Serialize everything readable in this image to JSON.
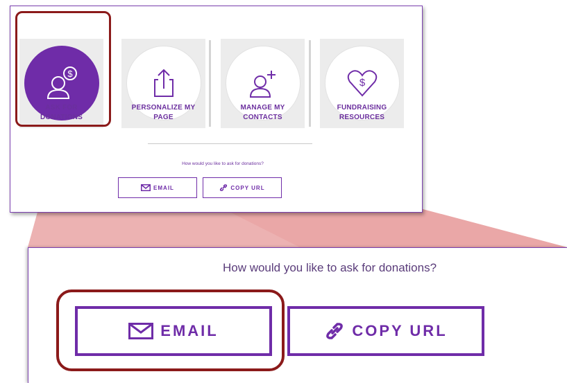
{
  "top_panel": {
    "tiles": [
      {
        "label": "ASK FOR\nDONATIONS",
        "icon": "ask-donations-icon",
        "active": true
      },
      {
        "label": "PERSONALIZE MY\nPAGE",
        "icon": "share-upload-icon",
        "active": false
      },
      {
        "label": "MANAGE MY\nCONTACTS",
        "icon": "add-contact-icon",
        "active": false
      },
      {
        "label": "FUNDRAISING\nRESOURCES",
        "icon": "heart-dollar-icon",
        "active": false
      }
    ],
    "question": "How would you like to ask for donations?",
    "email_label": "EMAIL",
    "copy_url_label": "COPY URL"
  },
  "zoom_panel": {
    "question": "How would you like to ask for donations?",
    "email_label": "EMAIL",
    "copy_url_label": "COPY URL"
  },
  "colors": {
    "brand_purple": "#6f2ca8",
    "highlight_red": "#8b1a1a",
    "wedge_pink": "#e9a5a5"
  }
}
